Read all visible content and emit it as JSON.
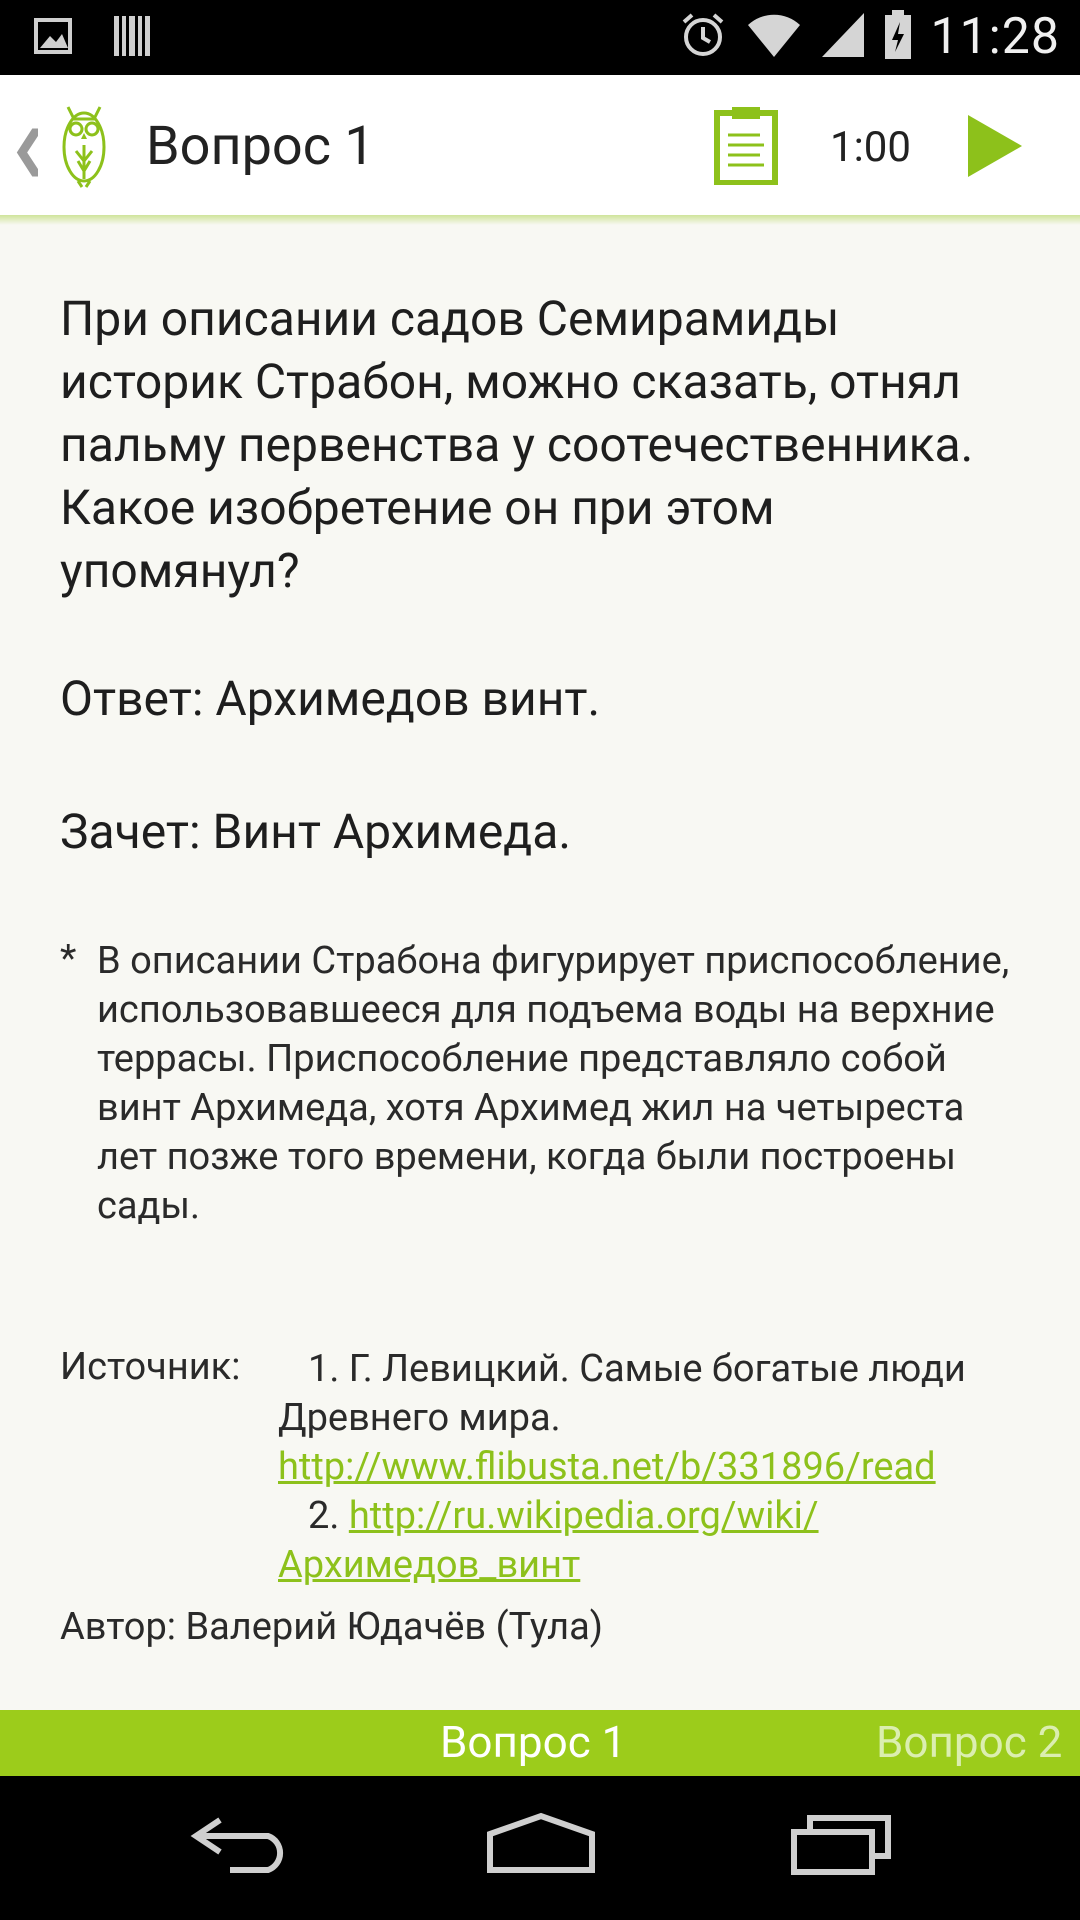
{
  "status_bar": {
    "time": "11:28",
    "left_icons": [
      "image-icon",
      "barcode-icon"
    ],
    "right_icons": [
      "alarm-icon",
      "wifi-icon",
      "signal-icon",
      "battery-icon"
    ]
  },
  "app_bar": {
    "back_glyph": "❮",
    "title": "Вопрос 1",
    "timer": "1:00",
    "accent_color": "#8dc11b"
  },
  "question": {
    "text": "При описании садов Семирамиды историк Страбон, можно сказать, отнял пальму первенства у соотечественника. Какое изобретение он при этом упомянул?",
    "answer_label": "Ответ:",
    "answer": "Архимедов винт.",
    "credit_label": "Зачет:",
    "credit": "Винт Архимеда.",
    "comment_marker": "*",
    "comment": "В описании Страбона фигурирует приспособление, использовавшееся для подъема воды на верхние террасы. Приспособление представляло собой винт Архимеда, хотя Архимед жил на четыреста лет позже того времени, когда были построены сады.",
    "source_label": "Источник:",
    "source_1_prefix": "1. Г. Левицкий. Самые богатые люди Древнего мира.",
    "source_1_link": "http://www.flibusta.net/b/331896/read",
    "source_2_prefix": "2.",
    "source_2_link": "http://ru.wikipedia.org/wiki/Архимедов_винт",
    "author_label": "Автор:",
    "author": "Валерий Юдачёв (Тула)"
  },
  "tabs": {
    "current": "Вопрос 1",
    "next": "Вопрос 2",
    "strip_color": "#9ccc1b"
  },
  "nav_bar": {
    "buttons": [
      "back-icon",
      "home-icon",
      "recents-icon"
    ]
  }
}
